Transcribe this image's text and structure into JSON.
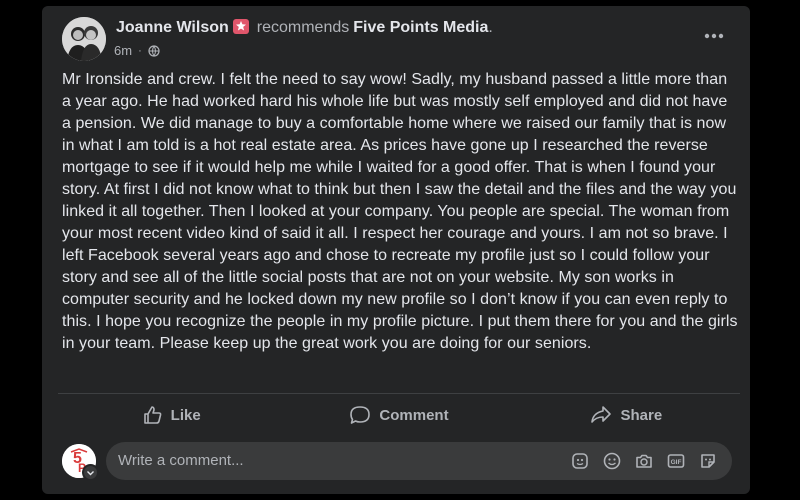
{
  "post": {
    "author": "Joanne Wilson",
    "verb": "recommends",
    "page": "Five Points Media",
    "period": ".",
    "time": "6m",
    "body": "Mr Ironside and crew. I felt the need to say wow! Sadly, my husband passed a little more than a year ago. He had worked hard his whole life but was mostly self employed and did not have a pension. We did manage to buy a comfortable home where we raised our family that is now in what I am told is a hot real estate area. As prices have gone up I researched the reverse mortgage to see if it would help me while I waited for a good offer. That is when I found your story. At first I did not know what to think but then I saw the detail and the files and the way you linked it all together. Then I looked at your company. You people are special. The woman from your most recent video kind of said it all. I respect her courage and yours. I am not so brave. I left Facebook several years ago and chose to recreate my profile just so I could follow your story and see all of the little social posts that are not on your website. My son works in computer security and he locked down my new profile so I don’t know if you can even reply to this. I hope you recognize the people in my profile picture. I put them there for you and the girls in your team. Please keep up the great work you are doing for our seniors."
  },
  "actions": {
    "like": "Like",
    "comment": "Comment",
    "share": "Share"
  },
  "comment_box": {
    "placeholder": "Write a comment..."
  },
  "icons": {
    "privacy": "globe-icon",
    "more": "more-options-icon",
    "like": "thumbs-up-icon",
    "comment": "comment-bubble-icon",
    "share": "share-arrow-icon",
    "avatar_sticker": "avatar-sticker-icon",
    "emoji": "emoji-icon",
    "camera": "camera-icon",
    "gif": "gif-icon",
    "sticker": "sticker-icon"
  },
  "colors": {
    "card_bg": "#242526",
    "text": "#e4e6eb",
    "muted": "#b0b3b8",
    "badge": "#e0566b",
    "brand_red": "#d93a3a"
  }
}
